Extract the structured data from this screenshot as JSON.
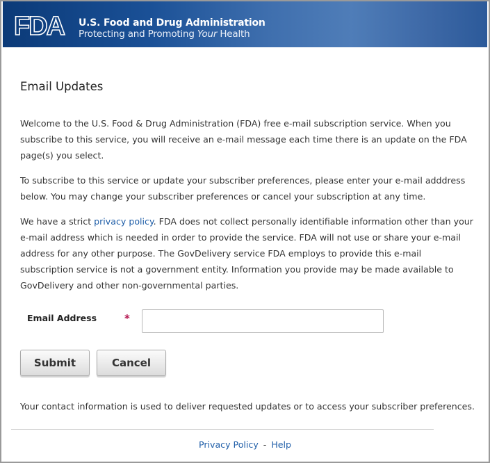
{
  "header": {
    "logo_text": "FDA",
    "agency_name": "U.S. Food and Drug Administration",
    "tagline_prefix": "Protecting and Promoting ",
    "tagline_emphasis": "Your",
    "tagline_suffix": " Health",
    "banner_color": "#1a5096"
  },
  "page": {
    "title": "Email Updates",
    "intro": "Welcome to the U.S. Food & Drug Administration (FDA) free e-mail subscription service. When you subscribe to this service, you will receive an e-mail message each time there is an update on the FDA page(s) you select.",
    "instructions": "To subscribe to this service or update your subscriber preferences, please enter your e-mail adddress below. You may change your subscriber preferences or cancel your subscription at any time.",
    "privacy_prefix": "We have a strict ",
    "privacy_link": "privacy policy",
    "privacy_suffix": ". FDA does not collect personally identifiable information other than your e-mail address which is needed in order to provide the service.  FDA will not use or share your e-mail address for any other purpose. The GovDelivery service FDA employs to provide this e-mail subscription service is not a government entity. Information you provide may be made available to GovDelivery and other non-governmental parties.",
    "link_color": "#1f5ea8"
  },
  "form": {
    "email_label": "Email Address",
    "required_mark": "*",
    "required_color": "#b3124d",
    "email_value": "",
    "email_placeholder": "",
    "submit_label": "Submit",
    "cancel_label": "Cancel"
  },
  "contact_note": "Your contact information is used to deliver requested updates or to access your subscriber preferences.",
  "footer": {
    "privacy_policy": "Privacy Policy",
    "separator": "-",
    "help": "Help"
  }
}
